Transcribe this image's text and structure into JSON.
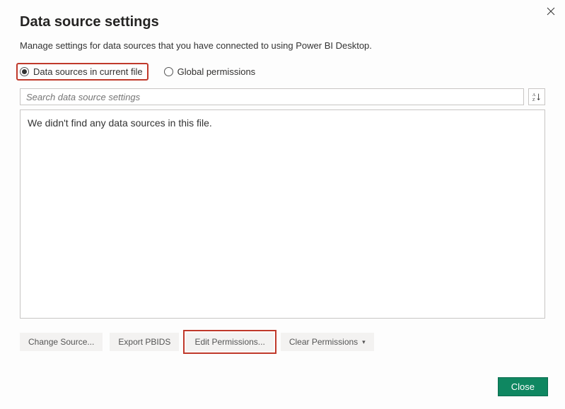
{
  "dialog": {
    "title": "Data source settings",
    "subtitle": "Manage settings for data sources that you have connected to using Power BI Desktop."
  },
  "radios": {
    "current_file": "Data sources in current file",
    "global": "Global permissions"
  },
  "search": {
    "placeholder": "Search data source settings"
  },
  "list": {
    "empty_message": "We didn't find any data sources in this file."
  },
  "buttons": {
    "change_source": "Change Source...",
    "export_pbids": "Export PBIDS",
    "edit_permissions": "Edit Permissions...",
    "clear_permissions": "Clear Permissions",
    "close": "Close"
  }
}
